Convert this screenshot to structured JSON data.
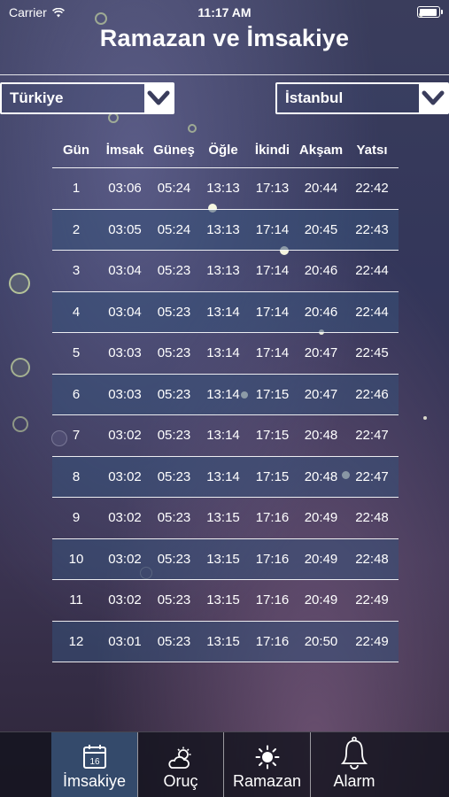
{
  "status_bar": {
    "carrier": "Carrier",
    "time": "11:17 AM"
  },
  "title": "Ramazan ve İmsakiye",
  "dropdowns": {
    "country": "Türkiye",
    "city": "İstanbul"
  },
  "table": {
    "headers": [
      "Gün",
      "İmsak",
      "Güneş",
      "Öğle",
      "İkindi",
      "Akşam",
      "Yatsı"
    ],
    "rows": [
      [
        "1",
        "03:06",
        "05:24",
        "13:13",
        "17:13",
        "20:44",
        "22:42"
      ],
      [
        "2",
        "03:05",
        "05:24",
        "13:13",
        "17:14",
        "20:45",
        "22:43"
      ],
      [
        "3",
        "03:04",
        "05:23",
        "13:13",
        "17:14",
        "20:46",
        "22:44"
      ],
      [
        "4",
        "03:04",
        "05:23",
        "13:14",
        "17:14",
        "20:46",
        "22:44"
      ],
      [
        "5",
        "03:03",
        "05:23",
        "13:14",
        "17:14",
        "20:47",
        "22:45"
      ],
      [
        "6",
        "03:03",
        "05:23",
        "13:14",
        "17:15",
        "20:47",
        "22:46"
      ],
      [
        "7",
        "03:02",
        "05:23",
        "13:14",
        "17:15",
        "20:48",
        "22:47"
      ],
      [
        "8",
        "03:02",
        "05:23",
        "13:14",
        "17:15",
        "20:48",
        "22:47"
      ],
      [
        "9",
        "03:02",
        "05:23",
        "13:15",
        "17:16",
        "20:49",
        "22:48"
      ],
      [
        "10",
        "03:02",
        "05:23",
        "13:15",
        "17:16",
        "20:49",
        "22:48"
      ],
      [
        "11",
        "03:02",
        "05:23",
        "13:15",
        "17:16",
        "20:49",
        "22:49"
      ],
      [
        "12",
        "03:01",
        "05:23",
        "13:15",
        "17:16",
        "20:50",
        "22:49"
      ]
    ]
  },
  "tabs": [
    {
      "label": "İmsakiye",
      "icon": "calendar-icon",
      "badge": "16",
      "active": true
    },
    {
      "label": "Oruç",
      "icon": "partly-cloudy-icon",
      "active": false
    },
    {
      "label": "Ramazan",
      "icon": "sun-icon",
      "active": false
    },
    {
      "label": "Alarm",
      "icon": "bell-icon",
      "active": false
    }
  ],
  "colors": {
    "shaded_row": "#375078",
    "active_tab": "#37506f",
    "text": "#ffffff"
  }
}
